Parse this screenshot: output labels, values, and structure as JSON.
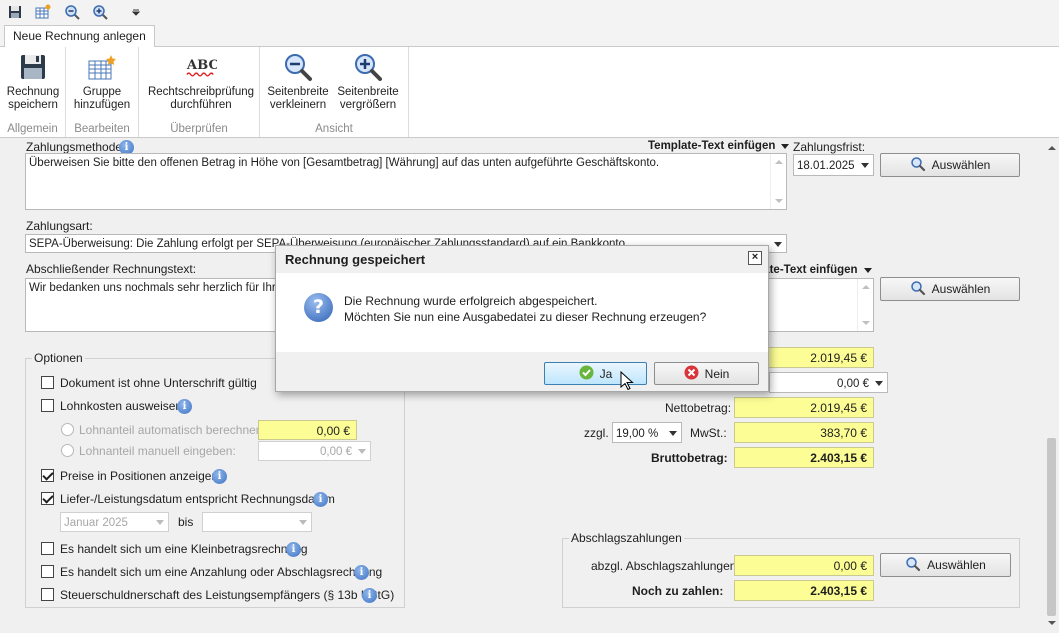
{
  "ribbon": {
    "tab": "Neue Rechnung anlegen",
    "groups": [
      {
        "label": "Allgemein",
        "button": "Rechnung\nspeichern",
        "icon": "save-icon"
      },
      {
        "label": "Bearbeiten",
        "button": "Gruppe\nhinzufügen",
        "icon": "add-group-icon"
      },
      {
        "label": "Überprüfen",
        "button": "Rechtschreibprüfung\ndurchführen",
        "icon": "spellcheck-icon"
      },
      {
        "label": "Ansicht",
        "buttons": [
          "Seitenbreite\nverkleinern",
          "Seitenbreite\nvergrößern"
        ]
      }
    ],
    "spell_icon_text": "ABC"
  },
  "form": {
    "zahlungsmethode_label": "Zahlungsmethode:",
    "template_insert": "Template-Text einfügen",
    "template_insert_partial": "late-Text einfügen",
    "zahlungsmethode_text": "Überweisen Sie bitte den offenen Betrag in Höhe von [Gesamtbetrag] [Währung] auf das unten aufgeführte Geschäftskonto.",
    "zahlungsfrist_label": "Zahlungsfrist:",
    "zahlungsfrist_value": "18.01.2025",
    "auswaehlen": "Auswählen",
    "zahlungsart_label": "Zahlungsart:",
    "zahlungsart_value": "SEPA-Überweisung: Die Zahlung erfolgt per SEPA-Überweisung (europäischer Zahlungsstandard) auf ein Bankkonto.",
    "abschluss_label": "Abschließender Rechnungstext:",
    "abschluss_text": "Wir bedanken uns nochmals sehr herzlich für Ihren"
  },
  "optionen": {
    "title": "Optionen",
    "items": [
      {
        "label": "Dokument ist ohne Unterschrift gültig",
        "checked": false
      },
      {
        "label": "Lohnkosten ausweisen",
        "checked": false
      },
      {
        "label": "Preise in Positionen anzeigen?",
        "checked": true
      },
      {
        "label": "Liefer-/Leistungsdatum entspricht Rechnungsdatum",
        "checked": true
      },
      {
        "label": "Es handelt sich um eine Kleinbetragsrechnung",
        "checked": false
      },
      {
        "label": "Es handelt sich um eine Anzahlung oder Abschlagsrechnung",
        "checked": false
      },
      {
        "label": "Steuerschuldnerschaft des Leistungsempfängers (§ 13b UStG)",
        "checked": false
      }
    ],
    "lohnanteil_auto": "Lohnanteil automatisch berechnen:",
    "lohnanteil_auto_value": "0,00 €",
    "lohnanteil_manuell": "Lohnanteil manuell eingeben:",
    "lohnanteil_manuell_value": "0,00 €",
    "date_from": "Januar 2025",
    "bis": "bis"
  },
  "summen": {
    "zwischensumme": "2.019,45 €",
    "rabatt": "0,00 €",
    "netto_label": "Nettobetrag:",
    "netto": "2.019,45 €",
    "zzgl": "zzgl.",
    "mwst_rate": "19,00 %",
    "mwst_label": "MwSt.:",
    "mwst": "383,70 €",
    "brutto_label": "Bruttobetrag:",
    "brutto": "2.403,15 €"
  },
  "abschlag": {
    "title": "Abschlagszahlungen",
    "abzgl_label": "abzgl. Abschlagszahlungen:",
    "abzgl_value": "0,00 €",
    "noch_label": "Noch zu zahlen:",
    "noch_value": "2.403,15 €"
  },
  "dialog": {
    "title": "Rechnung gespeichert",
    "message": "Die Rechnung wurde erfolgreich abgespeichert.\nMöchten Sie nun eine Ausgabedatei zu dieser Rechnung erzeugen?",
    "yes": "Ja",
    "no": "Nein"
  }
}
